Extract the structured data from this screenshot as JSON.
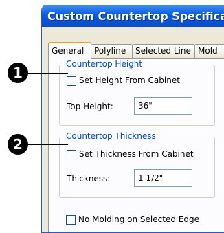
{
  "window": {
    "title": "Custom Countertop Specification"
  },
  "tabs": [
    {
      "label": "General"
    },
    {
      "label": "Polyline"
    },
    {
      "label": "Selected Line"
    },
    {
      "label": "Mold"
    }
  ],
  "height_group": {
    "legend": "Countertop Height",
    "checkbox_label": "Set Height From Cabinet",
    "checked": false,
    "field_label": "Top Height:",
    "field_value": "36\""
  },
  "thickness_group": {
    "legend": "Countertop Thickness",
    "checkbox_label": "Set Thickness From Cabinet",
    "checked": false,
    "field_label": "Thickness:",
    "field_value": "1 1/2\""
  },
  "no_molding": {
    "label": "No Molding on Selected Edge",
    "checked": false
  },
  "callouts": [
    "1",
    "2"
  ]
}
